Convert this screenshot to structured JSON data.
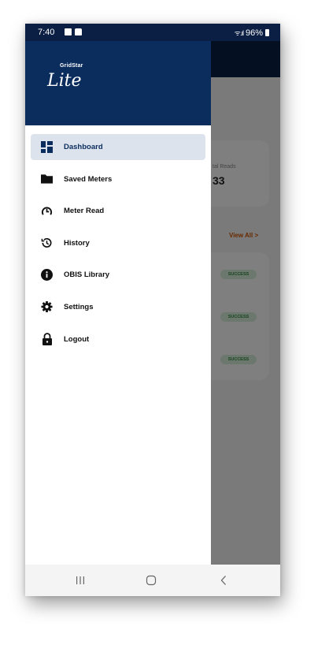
{
  "status_bar": {
    "time": "7:40",
    "battery_text": "96%"
  },
  "app": {
    "logo_small": "GridStar",
    "logo_main": "Lite"
  },
  "menu": {
    "items": [
      {
        "label": "Dashboard",
        "icon": "dashboard-icon",
        "active": true
      },
      {
        "label": "Saved Meters",
        "icon": "folder-icon",
        "active": false
      },
      {
        "label": "Meter Read",
        "icon": "meter-read-icon",
        "active": false
      },
      {
        "label": "History",
        "icon": "history-icon",
        "active": false
      },
      {
        "label": "OBIS Library",
        "icon": "info-icon",
        "active": false
      },
      {
        "label": "Settings",
        "icon": "gear-icon",
        "active": false
      },
      {
        "label": "Logout",
        "icon": "lock-icon",
        "active": false
      }
    ]
  },
  "background": {
    "card_label": "tal Reads",
    "card_value": "33",
    "view_all": "View All >",
    "badges": [
      "SUCCESS",
      "SUCCESS",
      "SUCCESS"
    ]
  },
  "colors": {
    "header": "#0b2d5e",
    "active_item": "#dde3ec",
    "accent_orange": "#d35400",
    "success": "#2e8b3e"
  }
}
